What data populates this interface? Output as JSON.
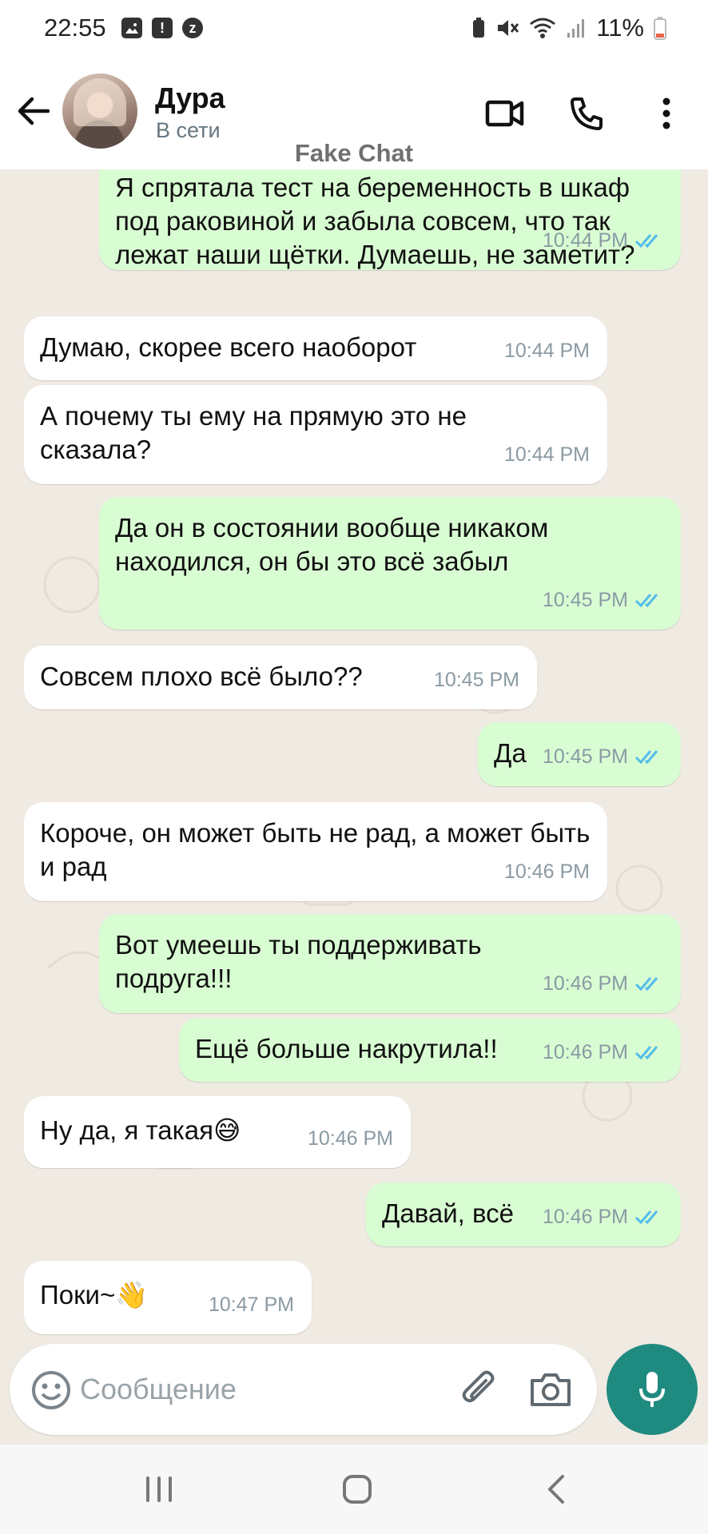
{
  "status_bar": {
    "time": "22:55",
    "battery": "11%"
  },
  "header": {
    "contact_name": "Дура",
    "contact_status": "В сети",
    "watermark": "Fake Chat"
  },
  "messages": [
    {
      "dir": "out",
      "text": "Я спрятала тест на беременность в шкаф под раковиной и забыла совсем, что так лежат наши щётки. Думаешь, не заметит?",
      "time": "10:44 PM"
    },
    {
      "dir": "in",
      "text": "Думаю, скорее всего наоборот",
      "time": "10:44 PM"
    },
    {
      "dir": "in",
      "text": "А почему ты ему на прямую это не сказала?",
      "time": "10:44 PM"
    },
    {
      "dir": "out",
      "text": "Да он в состоянии вообще никаком находился, он бы это всё забыл",
      "time": "10:45 PM"
    },
    {
      "dir": "in",
      "text": "Совсем плохо всё было??",
      "time": "10:45 PM"
    },
    {
      "dir": "out",
      "text": "Да",
      "time": "10:45 PM"
    },
    {
      "dir": "in",
      "text": "Короче, он может быть не рад, а может быть и рад",
      "time": "10:46 PM"
    },
    {
      "dir": "out",
      "text": "Вот умеешь ты поддерживать подруга!!!",
      "time": "10:46 PM"
    },
    {
      "dir": "out",
      "text": "Ещё больше накрутила!!",
      "time": "10:46 PM"
    },
    {
      "dir": "in",
      "text": "Ну да, я такая😅",
      "time": "10:46 PM"
    },
    {
      "dir": "out",
      "text": "Давай, всё",
      "time": "10:46 PM"
    },
    {
      "dir": "in",
      "text": "Поки~👋",
      "time": "10:47 PM"
    }
  ],
  "composer": {
    "placeholder": "Сообщение"
  },
  "colors": {
    "incoming": "#ffffff",
    "outgoing": "#d9fdd3",
    "accent": "#1f8a80",
    "read_ticks": "#53bdeb",
    "background": "#efeae2"
  },
  "icons": [
    "arrow-left-icon",
    "video-call-icon",
    "phone-icon",
    "more-vert-icon",
    "emoji-icon",
    "paperclip-icon",
    "camera-icon",
    "mic-icon",
    "recents-icon",
    "home-icon",
    "back-icon"
  ]
}
